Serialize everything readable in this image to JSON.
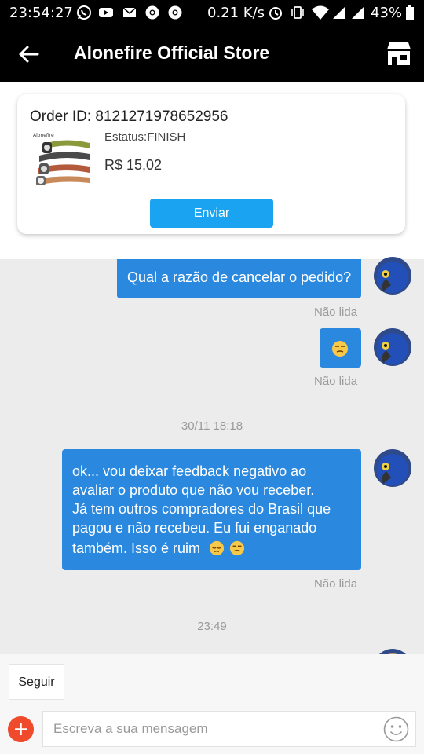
{
  "status_bar": {
    "time": "23:54:27",
    "net_speed": "0.21 K/s",
    "battery": "43%",
    "left_icons": [
      "whatsapp-icon",
      "youtube-icon",
      "mail-icon",
      "chrome-icon",
      "chrome-icon"
    ],
    "right_icons": [
      "alarm-icon",
      "vibrate-icon",
      "wifi-icon",
      "signal-icon",
      "signal-icon",
      "battery-icon"
    ]
  },
  "header": {
    "title": "Alonefire Official Store",
    "back_icon": "arrow-left-icon",
    "store_icon": "store-icon"
  },
  "order_card": {
    "order_id": "Order ID: 8121271978652956",
    "status": "Estatus:FINISH",
    "price": "R$ 15,02",
    "send_button": "Enviar"
  },
  "messages": [
    {
      "text": "Qual a razão de cancelar o pedido?",
      "read_status": "Não lida"
    },
    {
      "emoji": "unamused-face",
      "read_status": "Não lida"
    },
    {
      "timestamp": "30/11 18:18"
    },
    {
      "lines": [
        "ok... vou deixar feedback negativo ao",
        "avaliar o produto que não vou receber.",
        "Já tem outros compradores do Brasil que",
        "pagou e não recebeu. Eu fui enganado",
        "também. Isso é ruim"
      ],
      "emojis": [
        "pensive-face",
        "unamused-face"
      ],
      "read_status": "Não lida"
    },
    {
      "timestamp": "23:49"
    }
  ],
  "composer": {
    "follow_button": "Seguir",
    "placeholder": "Escreva a sua mensagem",
    "plus_icon": "plus-icon",
    "emoji_icon": "smiley-icon"
  },
  "colors": {
    "bubble": "#2a88df",
    "accent": "#1aa3f0",
    "plus": "#f04a2c",
    "header": "#000000",
    "chat_bg": "#ececec"
  }
}
